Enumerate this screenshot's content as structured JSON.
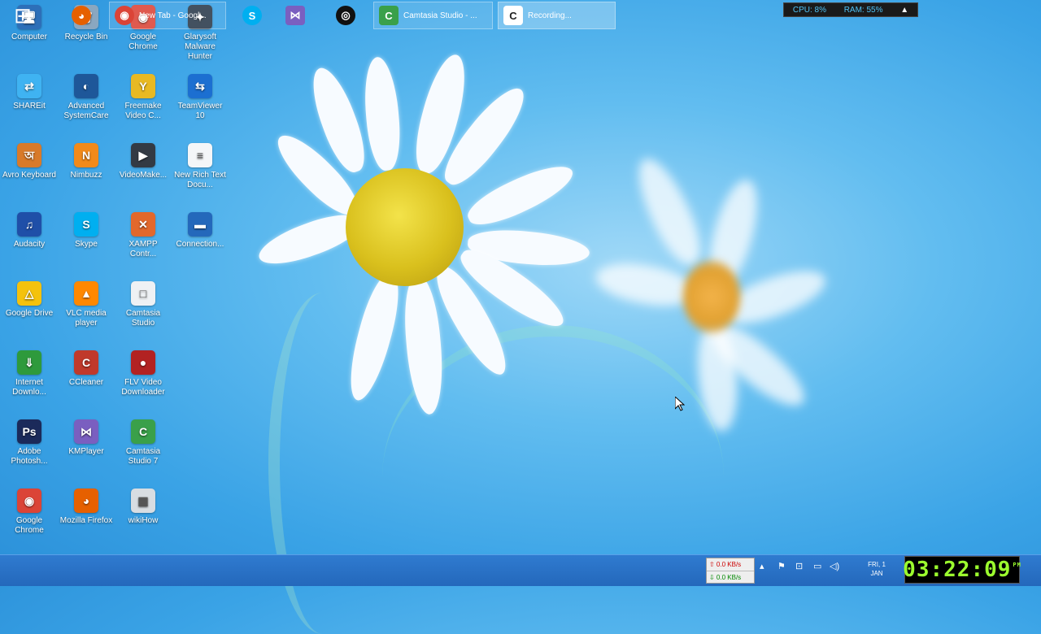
{
  "desktop": {
    "icons": [
      {
        "label": "Computer",
        "glyph": "🖥",
        "color": "#2d6fb8"
      },
      {
        "label": "Recycle Bin",
        "glyph": "🗑",
        "color": "#8aa7c0"
      },
      {
        "label": "Google Chrome",
        "glyph": "◉",
        "color": "#db4437"
      },
      {
        "label": "Glarysoft Malware Hunter",
        "glyph": "✦",
        "color": "#2a3a4a"
      },
      {
        "label": "SHAREit",
        "glyph": "⇄",
        "color": "#3fb3f2"
      },
      {
        "label": "Advanced SystemCare",
        "glyph": "◐",
        "color": "#1e5799"
      },
      {
        "label": "Freemake Video C...",
        "glyph": "Y",
        "color": "#e8b923"
      },
      {
        "label": "TeamViewer 10",
        "glyph": "⇆",
        "color": "#1c6fd1"
      },
      {
        "label": "Avro Keyboard",
        "glyph": "অ",
        "color": "#d87a2a"
      },
      {
        "label": "Nimbuzz",
        "glyph": "N",
        "color": "#f28a1a"
      },
      {
        "label": "VideoMake...",
        "glyph": "▶",
        "color": "#333a44"
      },
      {
        "label": "New Rich Text Docu...",
        "glyph": "≡",
        "color": "#f4f6f8"
      },
      {
        "label": "Audacity",
        "glyph": "♫",
        "color": "#1f4fa8"
      },
      {
        "label": "Skype",
        "glyph": "S",
        "color": "#00aff0"
      },
      {
        "label": "XAMPP Contr...",
        "glyph": "✕",
        "color": "#e2682c"
      },
      {
        "label": "Connection...",
        "glyph": "▬",
        "color": "#2468bb"
      },
      {
        "label": "Google Drive",
        "glyph": "△",
        "color": "#f4c20d"
      },
      {
        "label": "VLC media player",
        "glyph": "▲",
        "color": "#ff8800"
      },
      {
        "label": "Camtasia Studio",
        "glyph": "□",
        "color": "#eef1f4"
      },
      {
        "label": "Internet Downlo...",
        "glyph": "⇓",
        "color": "#2e9a3c"
      },
      {
        "label": "CCleaner",
        "glyph": "C",
        "color": "#c0392b"
      },
      {
        "label": "FLV Video Downloader",
        "glyph": "●",
        "color": "#b22222"
      },
      {
        "label": "Adobe Photosh...",
        "glyph": "Ps",
        "color": "#1b2a5a"
      },
      {
        "label": "KMPlayer",
        "glyph": "⋈",
        "color": "#7a5fc0"
      },
      {
        "label": "Camtasia Studio 7",
        "glyph": "C",
        "color": "#3aa04a"
      },
      {
        "label": "Google Chrome",
        "glyph": "◉",
        "color": "#db4437"
      },
      {
        "label": "Mozilla Firefox",
        "glyph": "◕",
        "color": "#e66000"
      },
      {
        "label": "wikiHow",
        "glyph": "▦",
        "color": "#d8dde2"
      }
    ]
  },
  "meter": {
    "cpu": "CPU: 8%",
    "ram": "RAM: 55%",
    "arrow": "▲"
  },
  "taskbar": {
    "start_glyph": "⊞",
    "firefox_glyph": "◕",
    "chrome_label": "New Tab - Googl...",
    "chrome_glyph": "◉",
    "skype_glyph": "S",
    "kmplayer_glyph": "⋈",
    "obs_glyph": "◎",
    "camtasia_label": "Camtasia Studio - ...",
    "camtasia_glyph": "C",
    "recording_label": "Recording...",
    "recording_glyph": "C",
    "net_up": "⇧ 0.0 KB/s",
    "net_down": "⇩ 0.0 KB/s",
    "tray_chevron": "▴",
    "tray_flag": "⚑",
    "tray_network": "⊡",
    "tray_battery": "▭",
    "tray_volume": "◁)",
    "date_line1": "FRI, 1",
    "date_line2": "JAN",
    "clock": "03:22:09",
    "clock_ampm": "PM"
  }
}
